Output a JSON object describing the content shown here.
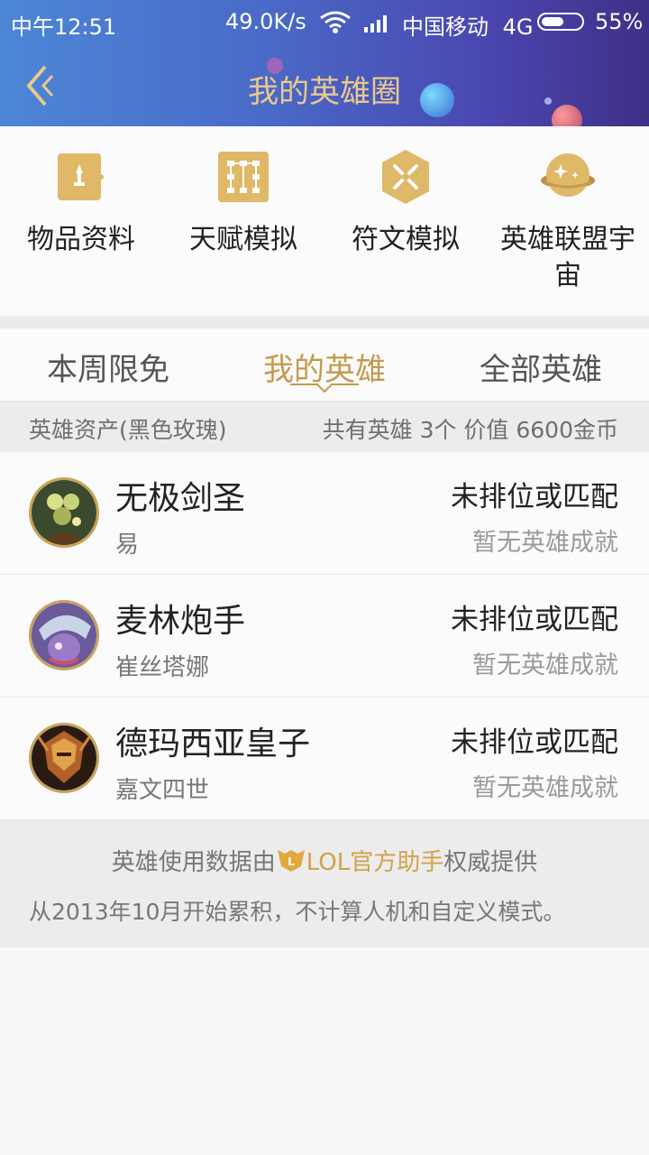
{
  "status_bar": {
    "time": "中午12:51",
    "speed": "49.0K/s",
    "carrier": "中国移动",
    "network": "4G",
    "battery_pct": "55%",
    "battery_level": 0.55
  },
  "header": {
    "title": "我的英雄圈"
  },
  "tools": [
    {
      "label": "物品资料",
      "icon": "item-icon"
    },
    {
      "label": "天赋模拟",
      "icon": "talent-icon"
    },
    {
      "label": "符文模拟",
      "icon": "rune-icon"
    },
    {
      "label": "英雄联盟宇宙",
      "icon": "universe-icon"
    }
  ],
  "tabs": [
    {
      "label": "本周限免"
    },
    {
      "label": "我的英雄",
      "active": true
    },
    {
      "label": "全部英雄"
    }
  ],
  "summary": {
    "left": "英雄资产(黑色玫瑰)",
    "right": "共有英雄 3个  价值 6600金币"
  },
  "heroes": [
    {
      "name": "无极剑圣",
      "subname": "易",
      "rank": "未排位或匹配",
      "achievement": "暂无英雄成就"
    },
    {
      "name": "麦林炮手",
      "subname": "崔丝塔娜",
      "rank": "未排位或匹配",
      "achievement": "暂无英雄成就"
    },
    {
      "name": "德玛西亚皇子",
      "subname": "嘉文四世",
      "rank": "未排位或匹配",
      "achievement": "暂无英雄成就"
    }
  ],
  "footer": {
    "line1_prefix": "英雄使用数据由",
    "line1_brand": "LOL官方助手",
    "line1_suffix": "权威提供",
    "line2": "从2013年10月开始累积，不计算人机和自定义模式。"
  },
  "colors": {
    "accent": "#c49a4d",
    "title": "#e9c98d",
    "header_start": "#4d86d6",
    "header_end": "#3f2f86"
  }
}
